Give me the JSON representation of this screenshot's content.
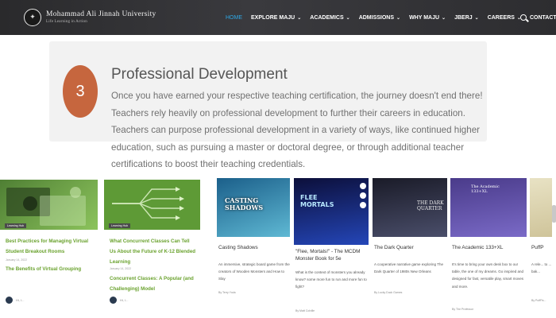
{
  "nav": {
    "logo": {
      "name": "Mohammad Ali Jinnah University",
      "tagline": "Life Learning in Action"
    },
    "items": [
      {
        "label": "HOME",
        "caret": false,
        "active": true
      },
      {
        "label": "EXPLORE MAJU",
        "caret": true,
        "active": false
      },
      {
        "label": "ACADEMICS",
        "caret": true,
        "active": false
      },
      {
        "label": "ADMISSIONS",
        "caret": true,
        "active": false
      },
      {
        "label": "WHY MAJU",
        "caret": true,
        "active": false
      },
      {
        "label": "JBERJ",
        "caret": true,
        "active": false
      },
      {
        "label": "CAREERS",
        "caret": true,
        "active": false
      },
      {
        "label": "CONTACT",
        "caret": false,
        "active": false
      }
    ],
    "active_color": "#2ea8e6"
  },
  "section": {
    "number": "3",
    "title": "Professional Development",
    "text": "Once you have earned your respective teaching certification, the journey doesn't end there! Teachers rely heavily on professional development to further their careers in education. Teachers can purpose professional development in a variety of ways, like continued higher education, such as pursuing a master or doctoral degree, or through additional teacher certifications to boost their teaching credentials.",
    "accent_color": "#c6663e"
  },
  "left_cards": [
    {
      "tag": "Learning Hub",
      "title": "Best Practices for Managing Virtual Student Breakout Rooms",
      "date": "January 14, 2022",
      "subtitle": "The Benefits of Virtual Grouping",
      "author": "Hi, I..."
    },
    {
      "tag": "Learning Hub",
      "title": "What Concurrent Classes Can Tell Us About the Future of K-12 Blended Learning",
      "date": "January 14, 2022",
      "subtitle": "Concurrent Classes: A Popular (and Challenging) Model",
      "author": "Hi, I..."
    }
  ],
  "right_cards": [
    {
      "title": "Casting Shadows",
      "desc": "An immersive, strategic board game from the creators of Wooden Monsters and How to Slay",
      "by": "By Terry Yoda",
      "image_text": "CASTING SHADOWS",
      "colors": [
        "#1b5f8a",
        "#5fb9d4"
      ]
    },
    {
      "title": "\"Flee, Mortals!\" - The MCDM Monster Book for 5e",
      "desc": "What is the context of monsters you already know? some more fun to run and more fun to fight?",
      "by": "By Matt Colville",
      "image_text": "FLEE MORTALS",
      "colors": [
        "#0c0f3a",
        "#2446b8"
      ]
    },
    {
      "title": "The Dark Quarter",
      "desc": "A cooperative narrative game exploring The Dark Quarter of 1980s New Orleans",
      "by": "By Lucky Duck Games",
      "image_text": "THE DARK QUARTER",
      "colors": [
        "#1a1b28",
        "#4a4e6a"
      ]
    },
    {
      "title": "The Academic 133+XL",
      "desc": "It's time to bring your own desk box to our table, the one of my dreams. Go inspired and designed for fast, versatile play, smart moves and more.",
      "by": "By The Professor",
      "image_text": "The Academic 133+XL",
      "colors": [
        "#4a3b8a",
        "#7a6ac7"
      ]
    },
    {
      "title": "PuffP",
      "desc": "A rele... to ... bak...",
      "by": "By PuffPa...",
      "image_text": "",
      "colors": [
        "#e8e2c4",
        "#cfc49a"
      ]
    }
  ],
  "left_card_color": "#6aa22e"
}
